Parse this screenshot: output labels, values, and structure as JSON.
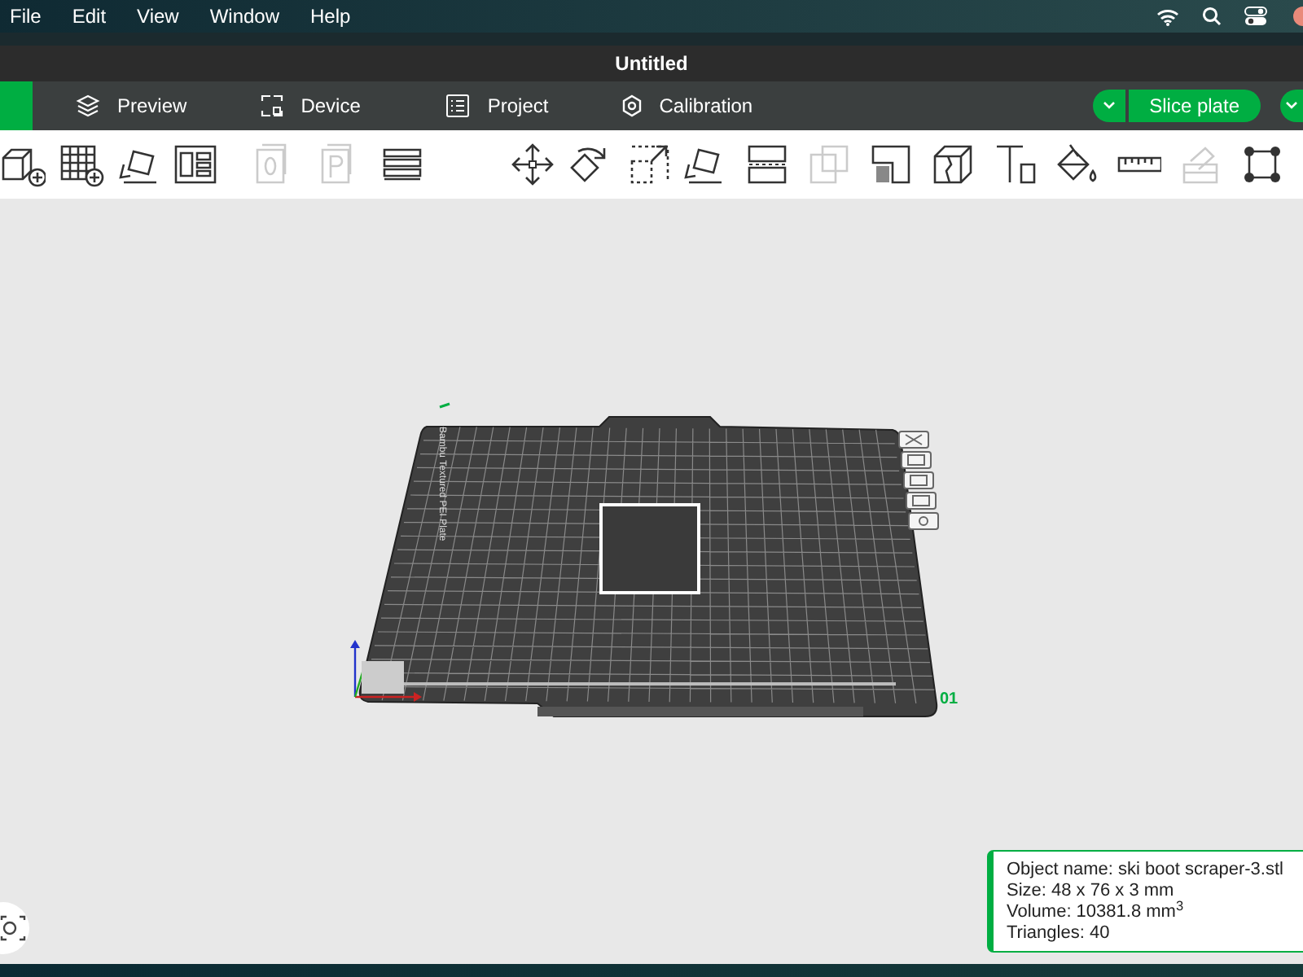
{
  "menu_bar": {
    "items": [
      "File",
      "Edit",
      "View",
      "Window",
      "Help"
    ]
  },
  "window": {
    "title": "Untitled"
  },
  "tabs": [
    {
      "label": "Preview"
    },
    {
      "label": "Device"
    },
    {
      "label": "Project"
    },
    {
      "label": "Calibration"
    }
  ],
  "slice_button": {
    "label": "Slice plate"
  },
  "toolbar": {
    "buttons": [
      {
        "disabled": false
      },
      {
        "disabled": false
      },
      {
        "disabled": false
      },
      {
        "disabled": false
      },
      {
        "disabled": true
      },
      {
        "disabled": true
      },
      {
        "disabled": false
      },
      {
        "disabled": false
      },
      {
        "disabled": false
      },
      {
        "disabled": false
      },
      {
        "disabled": false
      },
      {
        "disabled": false
      },
      {
        "disabled": true
      },
      {
        "disabled": false
      },
      {
        "disabled": false
      },
      {
        "disabled": false
      },
      {
        "disabled": false
      },
      {
        "disabled": false
      },
      {
        "disabled": true
      },
      {
        "disabled": false
      }
    ]
  },
  "plate": {
    "label": "Bambu Textured PEI Plate",
    "number": "01"
  },
  "info_panel": {
    "lines": [
      "Object name: ski boot scraper-3.stl",
      "Size: 48 x 76 x 3 mm",
      "Volume: 10381.8 mm$^{3}$",
      "Triangles: 40"
    ]
  }
}
